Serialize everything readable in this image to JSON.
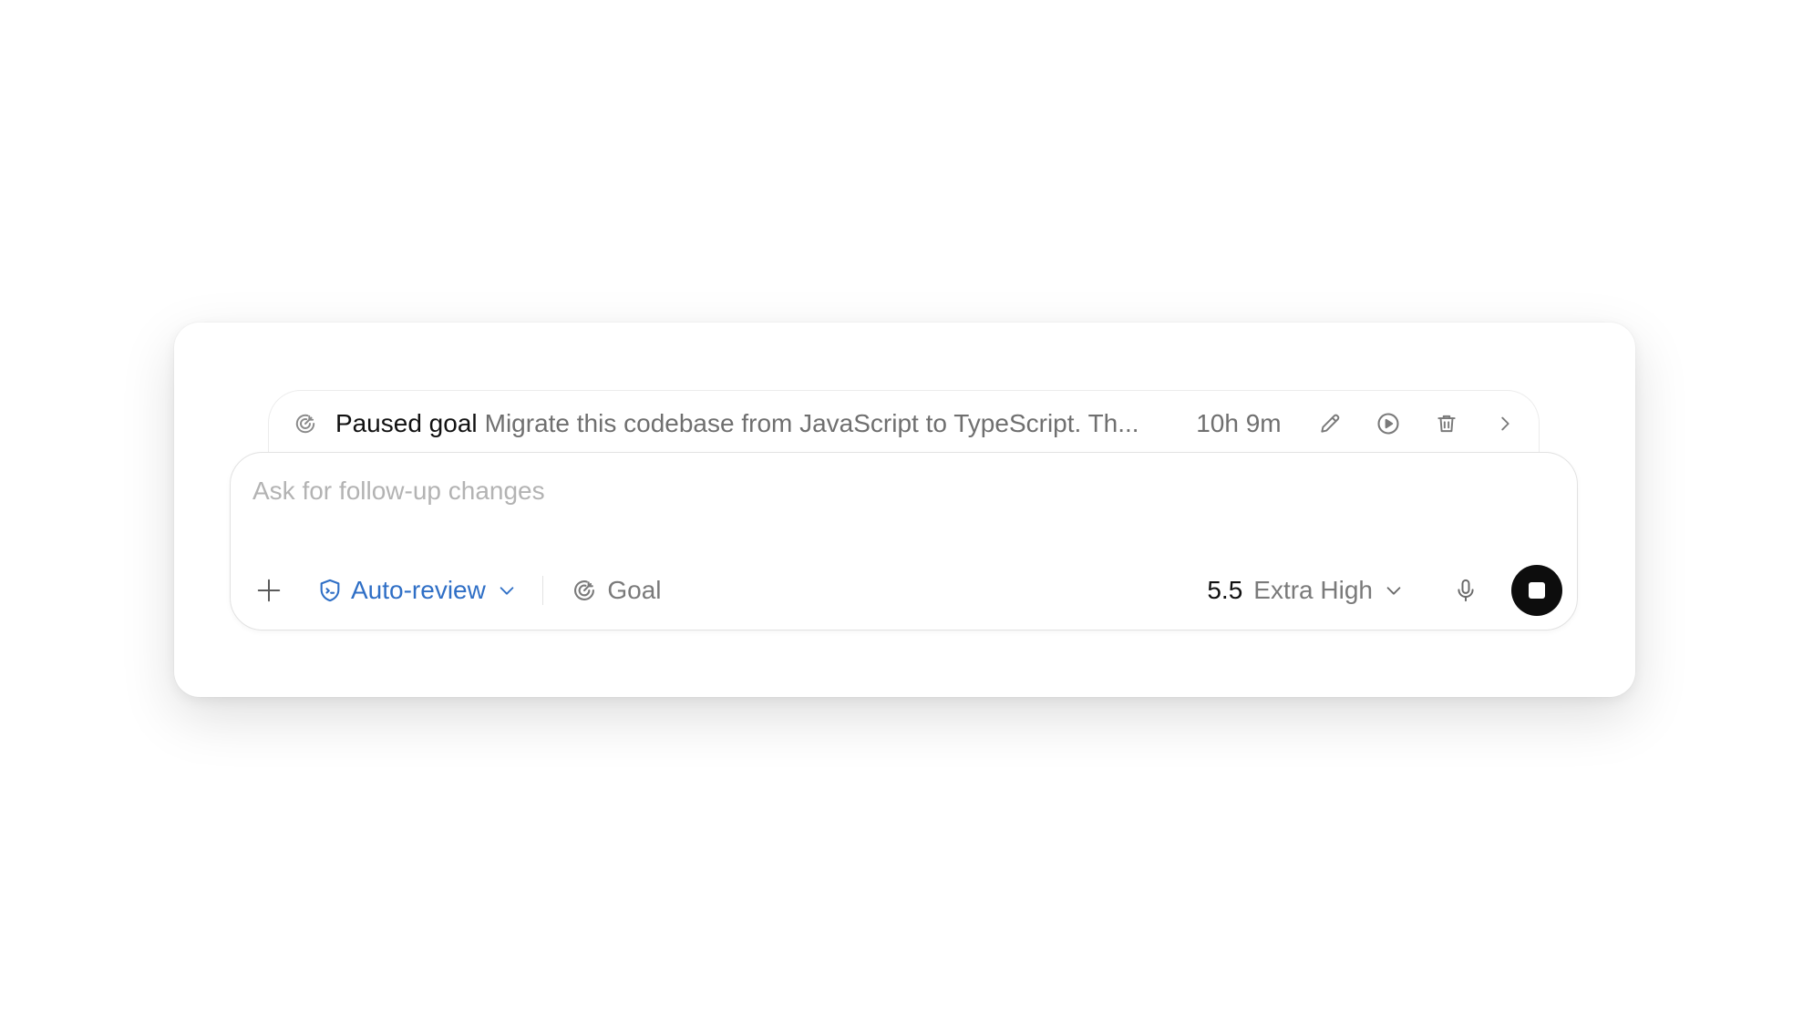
{
  "goal_bar": {
    "status_label": "Paused goal",
    "goal_text": "Migrate this codebase from JavaScript to TypeScript. Th...",
    "elapsed": "10h 9m",
    "icons": [
      "goal-icon",
      "edit-icon",
      "play-icon",
      "trash-icon",
      "chevron-right-icon"
    ]
  },
  "composer": {
    "placeholder": "Ask for follow-up changes",
    "value": ""
  },
  "toolbar": {
    "review_mode": "Auto-review",
    "goal_label": "Goal",
    "model_version": "5.5",
    "reasoning_effort": "Extra High",
    "icons": [
      "plus-icon",
      "shield-icon",
      "chevron-down-icon",
      "goal-icon",
      "microphone-icon",
      "stop-icon"
    ]
  },
  "colors": {
    "accent_blue": "#2f6fc6",
    "stop_button": "#0d0d0d",
    "muted_text": "#6f6f6f",
    "placeholder": "#b3b3b3"
  }
}
